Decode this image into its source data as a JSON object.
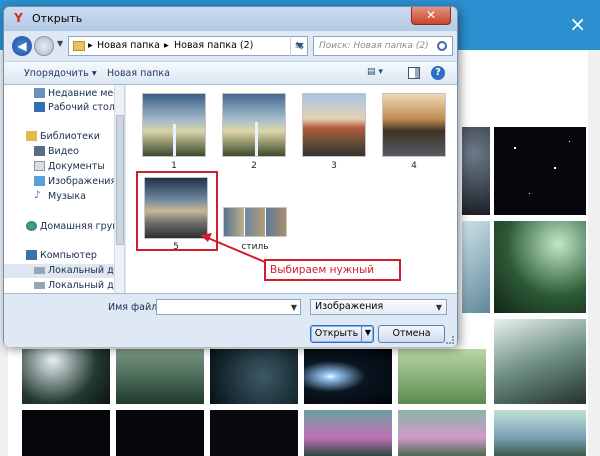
{
  "dialog": {
    "title": "Открыть",
    "close_label": "✕",
    "navigation": {
      "crumbs": [
        "Новая папка",
        "Новая папка (2)"
      ],
      "search_placeholder": "Поиск: Новая папка (2)"
    },
    "toolbar": {
      "organize": "Упорядочить",
      "new_folder": "Новая папка"
    },
    "nav_pane": {
      "items": [
        {
          "label": "Недавние места",
          "icon": "recent-places-icon"
        },
        {
          "label": "Рабочий стол",
          "icon": "desktop-icon"
        },
        {
          "label": "Библиотеки",
          "icon": "libraries-icon"
        },
        {
          "label": "Видео",
          "icon": "video-icon"
        },
        {
          "label": "Документы",
          "icon": "documents-icon"
        },
        {
          "label": "Изображения",
          "icon": "pictures-icon"
        },
        {
          "label": "Музыка",
          "icon": "music-icon"
        },
        {
          "label": "Домашняя группа",
          "icon": "homegroup-icon"
        },
        {
          "label": "Компьютер",
          "icon": "computer-icon"
        },
        {
          "label": "Локальный диск",
          "icon": "drive-icon"
        },
        {
          "label": "Локальный диск",
          "icon": "drive-icon"
        }
      ]
    },
    "files": [
      {
        "label": "1",
        "kind": "tree-sky"
      },
      {
        "label": "2",
        "kind": "tree-sky"
      },
      {
        "label": "3",
        "kind": "field-road"
      },
      {
        "label": "4",
        "kind": "road-sunset"
      },
      {
        "label": "5",
        "kind": "road-storm",
        "selected": true
      },
      {
        "label": "стиль",
        "kind": "collage"
      }
    ],
    "bottom": {
      "filename_label": "Имя файла:",
      "filename_value": "",
      "filetype_value": "Изображения",
      "open_button": "Открыть",
      "cancel_button": "Отмена"
    }
  },
  "annotation": {
    "text": "Выбираем нужный",
    "color": "#d01f2a"
  },
  "background": {
    "header_color": "#2c8fcf",
    "close_label": "×"
  }
}
